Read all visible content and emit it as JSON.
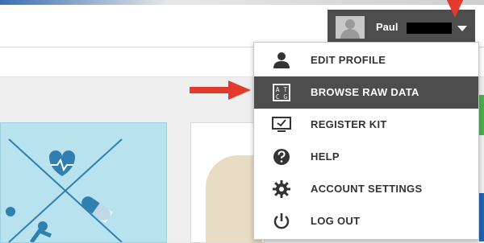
{
  "header": {
    "user_name": "Paul"
  },
  "menu": {
    "items": [
      {
        "label": "EDIT PROFILE",
        "icon": "person-icon"
      },
      {
        "label": "BROWSE RAW DATA",
        "icon": "dna-letters-icon",
        "active": true
      },
      {
        "label": "REGISTER KIT",
        "icon": "monitor-check-icon"
      },
      {
        "label": "HELP",
        "icon": "question-icon"
      },
      {
        "label": "ACCOUNT SETTINGS",
        "icon": "gear-icon"
      },
      {
        "label": "LOG OUT",
        "icon": "power-icon"
      }
    ],
    "dna_glyph_top": "A T",
    "dna_glyph_bottom": "C G"
  },
  "colors": {
    "header_pill": "#4d4d4d",
    "active_item": "#4d4d4d",
    "arrow": "#e23b2e",
    "card_left": "#b8e2ee"
  }
}
